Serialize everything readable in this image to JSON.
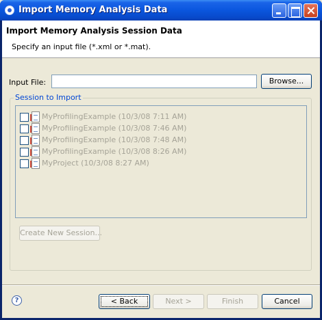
{
  "window": {
    "title": "Import Memory Analysis Data"
  },
  "header": {
    "title": "Import Memory Analysis Session Data",
    "description": "Specify an input file (*.xml or *.mat)."
  },
  "input": {
    "label": "Input File:",
    "value": "",
    "browse_label": "Browse..."
  },
  "session": {
    "group_label": "Session to Import",
    "items": [
      {
        "label": "MyProfilingExample (10/3/08 7:11 AM)",
        "checked": false
      },
      {
        "label": "MyProfilingExample (10/3/08 7:46 AM)",
        "checked": false
      },
      {
        "label": "MyProfilingExample (10/3/08 7:48 AM)",
        "checked": false
      },
      {
        "label": "MyProfilingExample (10/3/08 8:26 AM)",
        "checked": false
      },
      {
        "label": "MyProject (10/3/08 8:27 AM)",
        "checked": false
      }
    ],
    "create_label": "Create New Session..."
  },
  "footer": {
    "help_glyph": "?",
    "back_label": "< Back",
    "next_label": "Next >",
    "finish_label": "Finish",
    "cancel_label": "Cancel"
  }
}
